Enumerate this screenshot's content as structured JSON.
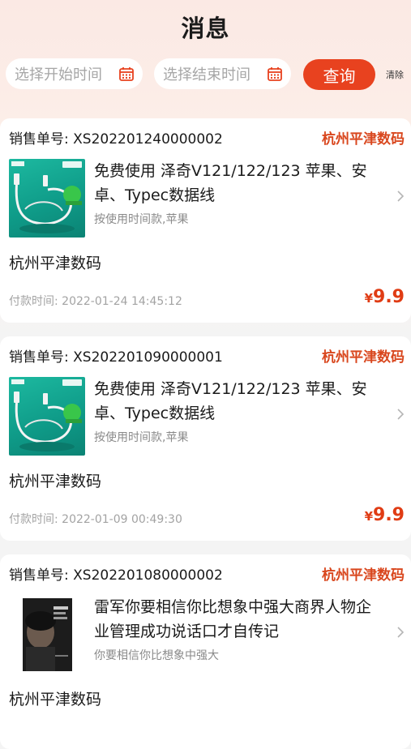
{
  "page": {
    "title": "消息"
  },
  "filter": {
    "start_placeholder": "选择开始时间",
    "end_placeholder": "选择结束时间",
    "query_label": "查询",
    "clear_label": "清除",
    "calendar_icon": "calendar-icon"
  },
  "colors": {
    "accent": "#e8421f",
    "price": "#e03c14",
    "shop_tag": "#d9471e"
  },
  "orders": [
    {
      "order_no": "销售单号: XS202201240000002",
      "shop_tag": "杭州平津数码",
      "product_name": "免费使用 泽奇V121/122/123 苹果、安卓、Typec数据线",
      "product_sub": "按使用时间款,苹果",
      "shop_name": "杭州平津数码",
      "pay_time": "付款时间: 2022-01-24 14:45:12",
      "currency": "¥",
      "price": "9.9",
      "thumb": "usb-cable-thumb"
    },
    {
      "order_no": "销售单号: XS202201090000001",
      "shop_tag": "杭州平津数码",
      "product_name": "免费使用 泽奇V121/122/123 苹果、安卓、Typec数据线",
      "product_sub": "按使用时间款,苹果",
      "shop_name": "杭州平津数码",
      "pay_time": "付款时间: 2022-01-09 00:49:30",
      "currency": "¥",
      "price": "9.9",
      "thumb": "usb-cable-thumb"
    },
    {
      "order_no": "销售单号: XS202201080000002",
      "shop_tag": "杭州平津数码",
      "product_name": "雷军你要相信你比想象中强大商界人物企业管理成功说话口才自传记",
      "product_sub": "你要相信你比想象中强大",
      "shop_name": "杭州平津数码",
      "thumb": "book-cover-thumb"
    }
  ]
}
